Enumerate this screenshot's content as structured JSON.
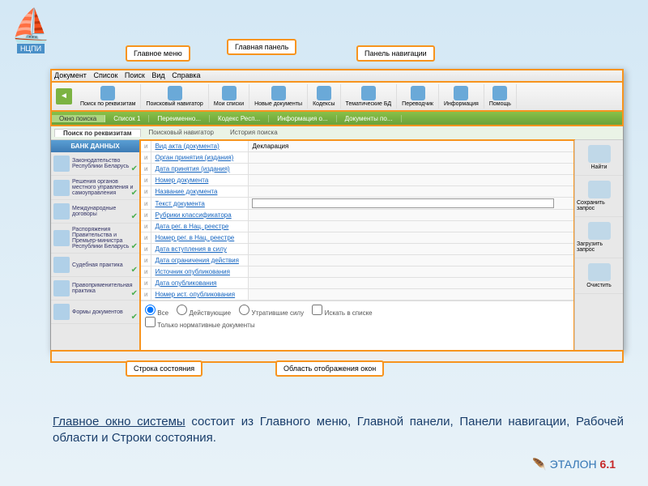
{
  "logo": {
    "text": "НЦПИ"
  },
  "callouts": {
    "main_menu": "Главное меню",
    "main_panel": "Главная панель",
    "nav_panel": "Панель навигации",
    "status_line": "Строка состояния",
    "display_area": "Область отображения окон"
  },
  "menubar": [
    "Документ",
    "Список",
    "Поиск",
    "Вид",
    "Справка"
  ],
  "mainbar": [
    "Поиск по реквизитам",
    "Поисковый навигатор",
    "Мои списки",
    "Новые документы",
    "Кодексы",
    "Тематические БД",
    "Переводчик",
    "Информация",
    "Помощь"
  ],
  "navbar": [
    "Окно поиска",
    "Список 1",
    "Переименно...",
    "Кодекс Респ...",
    "Информация о...",
    "Документы по..."
  ],
  "subbar": [
    "Поиск по реквизитам",
    "Поисковый навигатор",
    "История поиска"
  ],
  "sidebar": {
    "header": "БАНК ДАННЫХ",
    "items": [
      "Законодательство Республики Беларусь",
      "Решения органов местного управления и самоуправления",
      "Международные договоры",
      "Распоряжения Правительства и Премьер-министра Республики Беларусь",
      "Судебная практика",
      "Правоприменительная практика",
      "Формы документов"
    ]
  },
  "fields": [
    {
      "label": "Вид акта (документа)",
      "value": "Декларация"
    },
    {
      "label": "Орган принятия (издания)"
    },
    {
      "label": "Дата принятия (издания)"
    },
    {
      "label": "Номер документа"
    },
    {
      "label": "Название документа"
    },
    {
      "label": "Текст документа",
      "input": true
    },
    {
      "label": "Рубрики классификатора"
    },
    {
      "label": "Дата рег. в Нац. реестре"
    },
    {
      "label": "Номер рег. в Нац. реестре"
    },
    {
      "label": "Дата вступления в силу"
    },
    {
      "label": "Дата ограничения действия"
    },
    {
      "label": "Источник опубликования"
    },
    {
      "label": "Дата опубликования"
    },
    {
      "label": "Номер ист. опубликования"
    }
  ],
  "bottom_opts": {
    "all": "Все",
    "active": "Действующие",
    "inactive": "Утратившие силу",
    "inlist": "Искать в списке",
    "normonly": "Только нормативные документы"
  },
  "rightpanel": [
    "Найти",
    "Сохранить запрос",
    "Загрузить запрос",
    "Очистить"
  ],
  "description": {
    "t1": "Главное окно системы",
    "t2": " состоит из Главного меню, Главной панели, Панели навигации, Рабочей области и Строки состояния."
  },
  "footer": {
    "brand": "ЭТАЛОН",
    "ver": "6.1"
  }
}
